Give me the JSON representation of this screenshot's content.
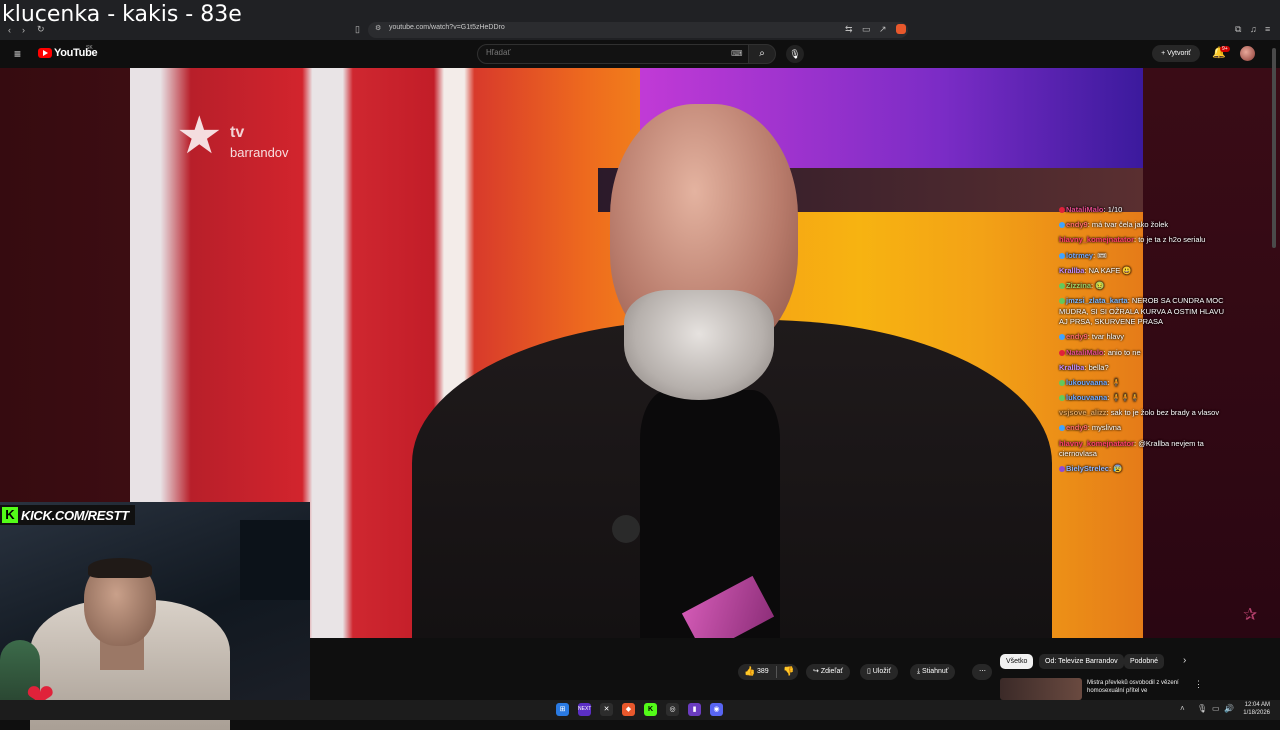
{
  "overlay_title": "klucenka - kakis - 83e",
  "browser": {
    "url": "youtube.com/watch?v=G1t5zHeDDro"
  },
  "youtube": {
    "logo": "YouTube",
    "region": "SK",
    "search_placeholder": "Hľadať",
    "create_label": "Vytvoriť",
    "notifications_badge": "9+"
  },
  "video": {
    "channel_logo_top": "tv",
    "channel_logo_brand": "barrandov"
  },
  "chat": [
    {
      "user": "NataliMalo",
      "text": "1/10",
      "color": "#e24b8d",
      "dot": "#e0223a"
    },
    {
      "user": "endy9",
      "text": "má tvar čela jako žolek",
      "color": "#ff6b6b",
      "dot": "#3fa3ff"
    },
    {
      "user": "hlavny_komejnatator",
      "text": "to je ta z h2o serialu",
      "color": "#ff3d6e",
      "dot": ""
    },
    {
      "user": "lotrmey",
      "text": "🎟",
      "color": "#6fa8ff",
      "dot": "#3fa3ff"
    },
    {
      "user": "Krallba",
      "text": "NA KAFE 😃",
      "color": "#c28bff",
      "dot": ""
    },
    {
      "user": "Zizzina",
      "text": "🤢",
      "color": "#9ad36a",
      "dot": "#63c95c"
    },
    {
      "user": "jmzsi_zlata_karta",
      "text": "NEROB SA CUNDRA MOC MUDRA, SI SI OŽRALA KURVA A OSTIM HLAVU AJ PRSA, SKURVENE PRASA",
      "color": "#7ab6ff",
      "dot": "#63c95c"
    },
    {
      "user": "endy9",
      "text": "tvar hlavy",
      "color": "#ff6b6b",
      "dot": "#3fa3ff"
    },
    {
      "user": "NataliMalo",
      "text": "anio to ne",
      "color": "#e24b8d",
      "dot": "#e0223a"
    },
    {
      "user": "Krallba",
      "text": "bella?",
      "color": "#c28bff",
      "dot": ""
    },
    {
      "user": "lukouvaana",
      "text": "🧍",
      "color": "#6fa8ff",
      "dot": "#63c95c"
    },
    {
      "user": "lukouvaana",
      "text": "🧍🧍🧍",
      "color": "#6fa8ff",
      "dot": "#63c95c"
    },
    {
      "user": "vsjsove_alizz",
      "text": "sak to je žolo bez brady a vlasov",
      "color": "#e0a560",
      "dot": ""
    },
    {
      "user": "endy9",
      "text": "myslivna",
      "color": "#ff6b6b",
      "dot": "#3fa3ff"
    },
    {
      "user": "hlavny_komejnatator",
      "text": "@Krallba nevjem ta ciernovlasa",
      "color": "#ff3d6e",
      "dot": ""
    },
    {
      "user": "BielyStrelec",
      "text": "😰",
      "color": "#8fb5ff",
      "dot": "#8e4ad6"
    }
  ],
  "webcam": {
    "kick_label": "KICK.COM/RESTT"
  },
  "actions": {
    "likes": "389",
    "share": "Zdieľať",
    "save": "Uložiť",
    "download": "Stiahnuť"
  },
  "filter_chips": [
    "Všetko",
    "Od: Televize Barrandov",
    "Podobné"
  ],
  "recommendation": {
    "title": "Mistra převleků osvobodil z vězení homosexuální přítel ve"
  },
  "taskbar": {
    "time": "12:04 AM",
    "date": "1/18/2026"
  },
  "colors": {
    "youtube_red": "#ff0000",
    "kick_green": "#53fc18"
  }
}
